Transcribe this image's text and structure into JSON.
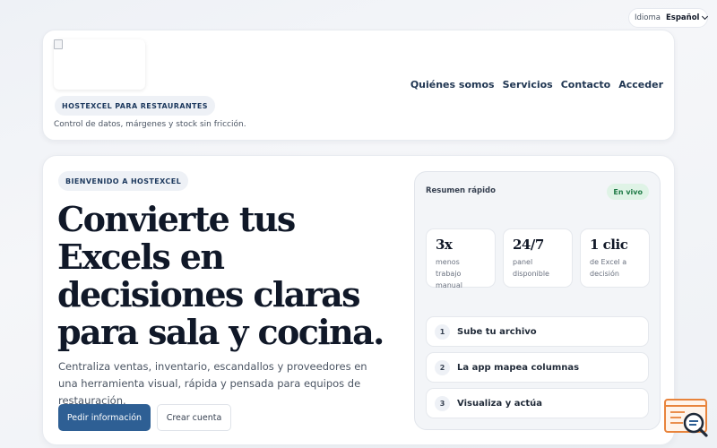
{
  "language": {
    "label": "Idioma",
    "selected": "Español",
    "icon": "chevron-down-icon"
  },
  "header": {
    "logo_alt": "",
    "brand_badge": "HOSTEXCEL PARA RESTAURANTES",
    "tagline": "Control de datos, márgenes y stock sin fricción.",
    "nav": [
      "Quiénes somos",
      "Servicios",
      "Contacto",
      "Acceder"
    ]
  },
  "hero": {
    "welcome_badge": "BIENVENIDO A HOSTEXCEL",
    "headline": "Convierte tus Excels en decisiones claras para sala y cocina.",
    "subtext": "Centraliza ventas, inventario, escandallos y proveedores en una herramienta visual, rápida y pensada para equipos de restauración.",
    "primary_button": "Pedir información",
    "secondary_button": "Crear cuenta"
  },
  "summary": {
    "title": "Resumen rápido",
    "live_badge": "En vivo",
    "stats": [
      {
        "value": "3x",
        "label": "menos trabajo manual"
      },
      {
        "value": "24/7",
        "label": "panel disponible"
      },
      {
        "value": "1 clic",
        "label": "de Excel a decisión"
      }
    ],
    "steps": [
      {
        "num": "1",
        "label": "Sube tu archivo"
      },
      {
        "num": "2",
        "label": "La app mapea columnas"
      },
      {
        "num": "3",
        "label": "Visualiza y actúa"
      }
    ]
  },
  "colors": {
    "primary": "#2e5f94",
    "live": "#1f7a46",
    "widget": "#e8843c"
  }
}
